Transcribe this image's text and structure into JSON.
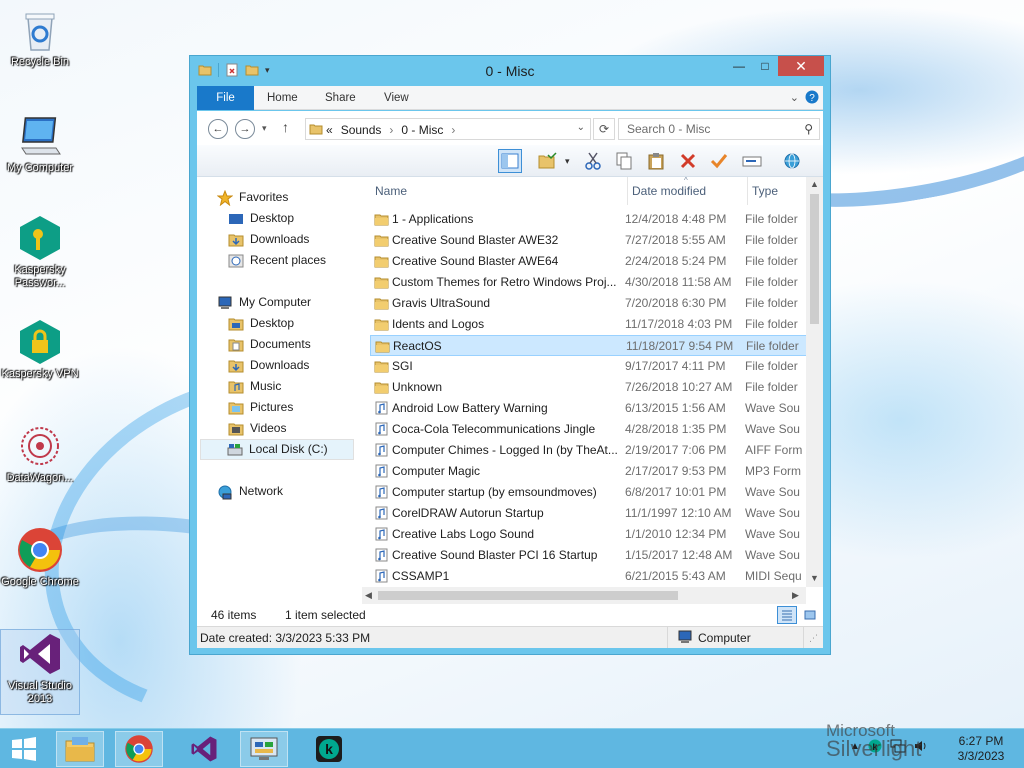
{
  "desktop": {
    "icons": [
      {
        "label": "Recycle Bin"
      },
      {
        "label": "My Computer"
      },
      {
        "label": "Kaspersky Passwor..."
      },
      {
        "label": "Kaspersky VPN"
      },
      {
        "label": "DataWagon..."
      },
      {
        "label": "Google Chrome"
      },
      {
        "label": "Visual Studio 2013"
      }
    ]
  },
  "window": {
    "title": "0 - Misc",
    "close_glyph": "✕",
    "maximize_glyph": "□",
    "minimize_glyph": "—"
  },
  "ribbon": {
    "tabs": [
      "File",
      "Home",
      "Share",
      "View"
    ]
  },
  "address": {
    "prefix": "«",
    "crumbs": [
      "Sounds",
      "0 - Misc"
    ]
  },
  "search": {
    "placeholder": "Search 0 - Misc"
  },
  "navpane": {
    "favorites": "Favorites",
    "fav_items": [
      "Desktop",
      "Downloads",
      "Recent places"
    ],
    "computer": "My Computer",
    "comp_items": [
      "Desktop",
      "Documents",
      "Downloads",
      "Music",
      "Pictures",
      "Videos",
      "Local Disk (C:)"
    ],
    "network": "Network"
  },
  "columns": {
    "name": "Name",
    "date": "Date modified",
    "type": "Type"
  },
  "files": [
    {
      "name": "1 - Applications",
      "date": "12/4/2018 4:48 PM",
      "type": "File folder",
      "kind": "folder"
    },
    {
      "name": "Creative Sound Blaster AWE32",
      "date": "7/27/2018 5:55 AM",
      "type": "File folder",
      "kind": "folder"
    },
    {
      "name": "Creative Sound Blaster AWE64",
      "date": "2/24/2018 5:24 PM",
      "type": "File folder",
      "kind": "folder"
    },
    {
      "name": "Custom Themes for Retro Windows Proj...",
      "date": "4/30/2018 11:58 AM",
      "type": "File folder",
      "kind": "folder"
    },
    {
      "name": "Gravis UltraSound",
      "date": "7/20/2018 6:30 PM",
      "type": "File folder",
      "kind": "folder"
    },
    {
      "name": "Idents and Logos",
      "date": "11/17/2018 4:03 PM",
      "type": "File folder",
      "kind": "folder"
    },
    {
      "name": "ReactOS",
      "date": "11/18/2017 9:54 PM",
      "type": "File folder",
      "kind": "folder",
      "selected": true
    },
    {
      "name": "SGI",
      "date": "9/17/2017 4:11 PM",
      "type": "File folder",
      "kind": "folder"
    },
    {
      "name": "Unknown",
      "date": "7/26/2018 10:27 AM",
      "type": "File folder",
      "kind": "folder"
    },
    {
      "name": "Android Low Battery Warning",
      "date": "6/13/2015 1:56 AM",
      "type": "Wave Sou",
      "kind": "audio"
    },
    {
      "name": "Coca-Cola Telecommunications Jingle",
      "date": "4/28/2018 1:35 PM",
      "type": "Wave Sou",
      "kind": "audio"
    },
    {
      "name": "Computer Chimes - Logged In (by TheAt...",
      "date": "2/19/2017 7:06 PM",
      "type": "AIFF Form",
      "kind": "audio"
    },
    {
      "name": "Computer Magic",
      "date": "2/17/2017 9:53 PM",
      "type": "MP3 Form",
      "kind": "audio"
    },
    {
      "name": "Computer startup (by emsoundmoves)",
      "date": "6/8/2017 10:01 PM",
      "type": "Wave Sou",
      "kind": "audio"
    },
    {
      "name": "CorelDRAW Autorun Startup",
      "date": "11/1/1997 12:10 AM",
      "type": "Wave Sou",
      "kind": "audio"
    },
    {
      "name": "Creative Labs Logo Sound",
      "date": "1/1/2010 12:34 PM",
      "type": "Wave Sou",
      "kind": "audio"
    },
    {
      "name": "Creative Sound Blaster PCI 16 Startup",
      "date": "1/15/2017 12:48 AM",
      "type": "Wave Sou",
      "kind": "audio"
    },
    {
      "name": "CSSAMP1",
      "date": "6/21/2015 5:43 AM",
      "type": "MIDI Sequ",
      "kind": "audio"
    }
  ],
  "status": {
    "count": "46 items",
    "selection": "1 item selected"
  },
  "details": {
    "created": "Date created: 3/3/2023 5:33 PM",
    "location": "Computer"
  },
  "taskbar": {
    "clock_time": "6:27 PM",
    "clock_date": "3/3/2023"
  },
  "watermark": {
    "line1": "Microsoft",
    "line2": "Silverlight"
  },
  "colors": {
    "accent": "#1979ca",
    "window_frame": "#6bc6ec",
    "taskbar": "#5fb7e1",
    "selection": "#cce8ff",
    "close": "#c7504b"
  }
}
